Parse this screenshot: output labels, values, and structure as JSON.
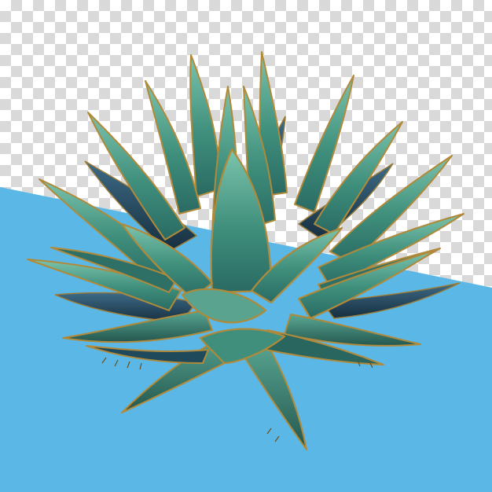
{
  "image": {
    "subject": "agave-plant",
    "background": "transparency-checkerboard",
    "colors": {
      "sky_blue": "#5bb8e6",
      "checker_light": "#ffffff",
      "checker_dark": "#d9d9d9",
      "leaf_main": "#3f8f7c",
      "leaf_light": "#6db7a2",
      "leaf_dark": "#1f4a5c",
      "leaf_edge": "#b08a3a",
      "shadow": "#0f2a33"
    }
  }
}
